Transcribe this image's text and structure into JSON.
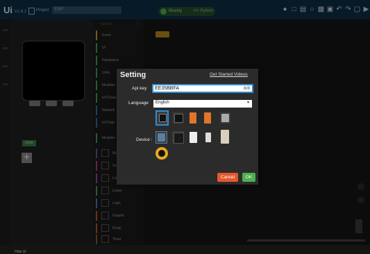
{
  "topbar": {
    "logo": "Ui",
    "version": "V1.6.1",
    "project_label": "Project",
    "project_value": "ESP",
    "mode_blockly": "Blockly",
    "mode_python": "</> Python",
    "icons": [
      "user-icon",
      "new-file-icon",
      "save-icon",
      "settings-icon",
      "download-icon",
      "upload-icon",
      "undo-icon",
      "redo-icon",
      "run-icon",
      "play-icon",
      "share-icon",
      "menu-icon"
    ]
  },
  "sidebar": {
    "search_placeholder": "Search",
    "units_label": "Units",
    "add_unit_label": "+",
    "hide_ui": "Hide UI",
    "categories": [
      {
        "name": "Event",
        "color": "#d99a1e"
      },
      {
        "name": "UI",
        "color": "#3aa65b"
      },
      {
        "name": "Hardwares",
        "color": "#3aa65b"
      },
      {
        "name": "Units",
        "color": "#3aa65b"
      },
      {
        "name": "Modules",
        "color": "#3aa65b"
      },
      {
        "name": "IoTCloud",
        "color": "#3aa65b"
      },
      {
        "name": "Network",
        "color": "#2d6fb1"
      },
      {
        "name": "IoTData",
        "color": "#2d6fb1"
      },
      {
        "name": "Modules",
        "color": "#3aa65b"
      },
      {
        "name": "Math",
        "color": "#5a5a9a"
      },
      {
        "name": "Variables",
        "color": "#c13a7a"
      },
      {
        "name": "Lists",
        "color": "#8a4ab3"
      },
      {
        "name": "Loops",
        "color": "#3aa65b"
      },
      {
        "name": "Logic",
        "color": "#4a7ab0"
      },
      {
        "name": "Graphic",
        "color": "#c15a1a"
      },
      {
        "name": "Emoji",
        "color": "#c15a1a"
      },
      {
        "name": "Timer",
        "color": "#8a5a2a"
      },
      {
        "name": "Functions",
        "color": "#9a3a7a"
      }
    ]
  },
  "dialog": {
    "title": "Setting",
    "help_link": "Get Started Videos",
    "api_key_label": "Api key",
    "api_key_value": "EE35BBFA",
    "api_key_count": "8/8",
    "language_label": "Language",
    "language_value": "English",
    "device_label": "Device :",
    "cancel_label": "Cancel",
    "ok_label": "OK"
  },
  "colors": {
    "accent": "#2b8fd6",
    "cancel": "#e4572e",
    "ok": "#4caf50",
    "topbar": "#0d2d44"
  }
}
